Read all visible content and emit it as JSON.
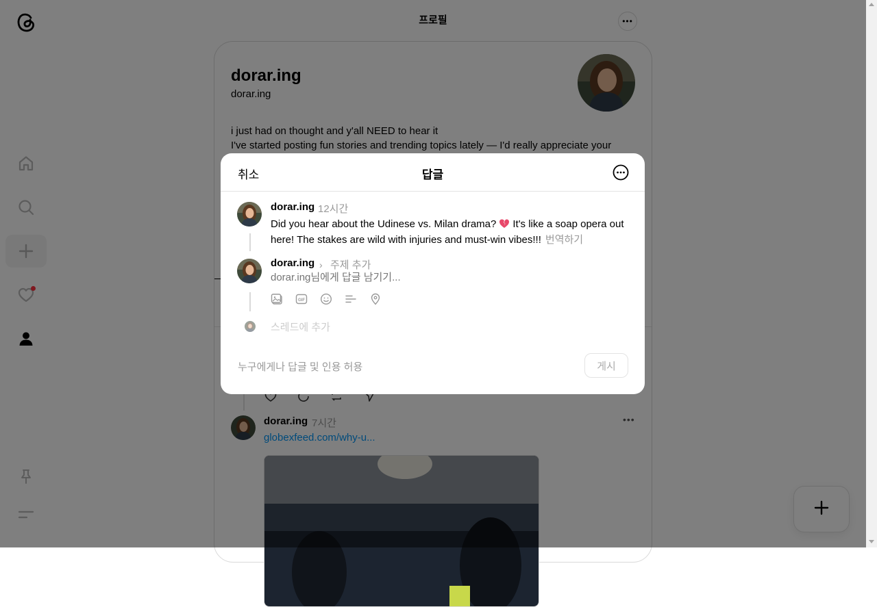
{
  "header": {
    "title": "프로필"
  },
  "profile": {
    "name": "dorar.ing",
    "handle": "dorar.ing",
    "bio_line1": "i just had on thought and y'all NEED to hear it",
    "bio_line2": "I've started posting fun stories and trending topics lately — I'd really appreciate your"
  },
  "background_post": {
    "username": "dorar.ing",
    "time": "7시간",
    "link_text": "globexfeed.com/why-u..."
  },
  "nav": {
    "items": [
      "home-icon",
      "search-icon",
      "create-icon",
      "activity-icon",
      "profile-icon",
      "pin-icon",
      "menu-icon"
    ],
    "notification_color": "#ff3040"
  },
  "modal": {
    "cancel_label": "취소",
    "title": "답글",
    "original": {
      "username": "dorar.ing",
      "time": "12시간",
      "text_before_emoji": "Did you hear about the Udinese vs. Milan drama?",
      "text_after_emoji": "It's like a soap opera out here! The stakes are wild with injuries and must-win vibes!!!",
      "translate_label": "번역하기"
    },
    "reply": {
      "username": "dorar.ing",
      "topic_placeholder": "주제 추가",
      "input_placeholder": "dorar.ing님에게 답글 남기기..."
    },
    "tools": [
      "image-icon",
      "gif-icon",
      "emoji-icon",
      "poll-icon",
      "location-icon"
    ],
    "add_thread_label": "스레드에 추가",
    "reply_permission_label": "누구에게나 답글 및 인용 허용",
    "post_label": "게시"
  },
  "colors": {
    "overlay": "rgba(0,0,0,0.5)",
    "muted": "#999999",
    "link": "#0095f6"
  }
}
